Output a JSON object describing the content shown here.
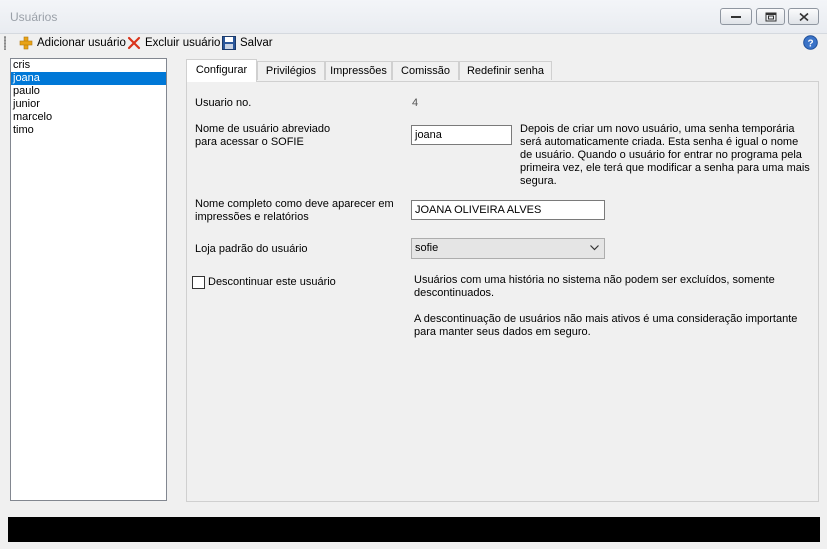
{
  "window": {
    "title": "Usuários"
  },
  "toolbar": {
    "add_label": "Adicionar usuário",
    "delete_label": "Excluir usuário",
    "save_label": "Salvar"
  },
  "users": {
    "items": [
      "cris",
      "joana",
      "paulo",
      "junior",
      "marcelo",
      "timo"
    ],
    "selected": "joana"
  },
  "tabs": [
    "Configurar",
    "Privilégios",
    "Impressões",
    "Comissão",
    "Redefinir senha"
  ],
  "active_tab": "Configurar",
  "form": {
    "user_no_label": "Usuario no.",
    "user_no_value": "4",
    "short_name_label_line1": "Nome de usuário abreviado",
    "short_name_label_line2": "para acessar o SOFIE",
    "short_name_value": "joana",
    "short_name_help": "Depois de criar um novo usuário, uma senha temporária será automaticamente criada. Esta senha é igual o nome de usuário. Quando o usuário for entrar no programa pela primeira vez, ele terá que modificar a senha para uma mais segura.",
    "full_name_label_line1": "Nome completo como deve aparecer em",
    "full_name_label_line2": "impressões e relatórios",
    "full_name_value": "JOANA OLIVEIRA ALVES",
    "store_label": "Loja padrão do usuário",
    "store_value": "sofie",
    "discontinue_label": "Descontinuar este usuário",
    "discontinue_checked": false,
    "discontinue_info1": "Usuários com uma história no sistema não podem ser excluídos, somente descontinuados.",
    "discontinue_info2": "A descontinuação de usuários não mais ativos é uma consideração importante para manter seus dados em seguro."
  },
  "icons": {
    "add": "plus-icon",
    "delete": "x-icon",
    "save": "floppy-disk-icon",
    "help": "help-question-icon"
  },
  "colors": {
    "selection": "#0078d7",
    "add_icon": "#e8a317",
    "delete_icon": "#d9341c",
    "save_icon": "#2b579a"
  }
}
